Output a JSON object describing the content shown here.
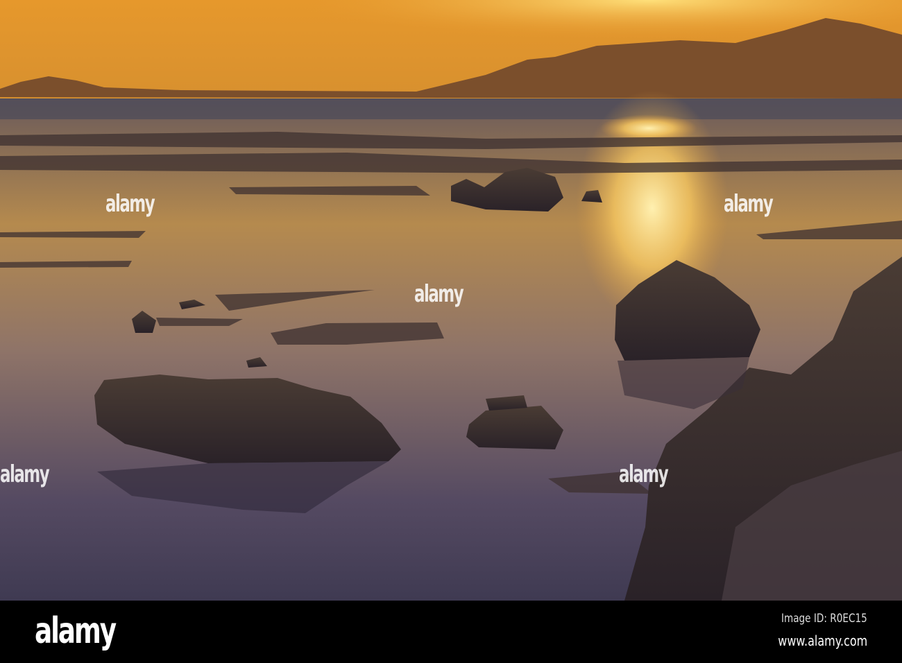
{
  "watermark": {
    "text": "alamy"
  },
  "footer": {
    "logo": "alamy",
    "image_id": "Image ID: R0EC15",
    "site": "www.alamy.com"
  },
  "colors": {
    "sky_top": "#e89a2a",
    "sky_bottom": "#d9922e",
    "mountain": "#7a4e2a",
    "water_dark": "#3a3346",
    "rock": "#2a2220"
  }
}
